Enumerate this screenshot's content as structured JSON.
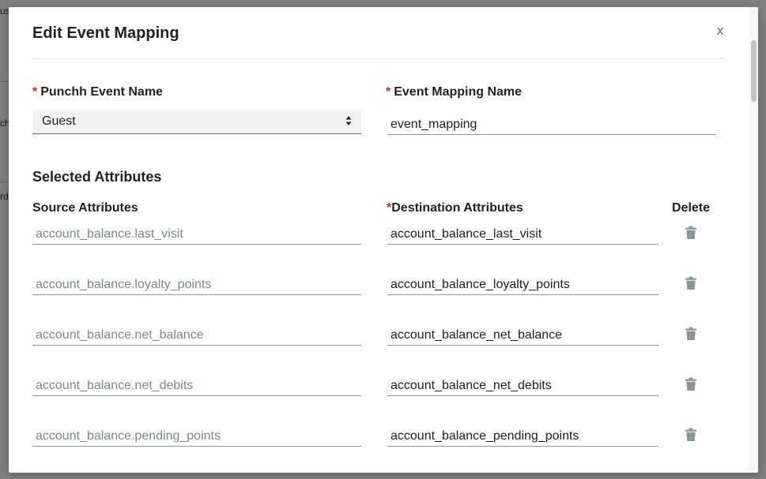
{
  "background": {
    "fragments": [
      "us",
      "ch",
      "rd"
    ]
  },
  "modal": {
    "title": "Edit Event Mapping",
    "close_label": "x",
    "event_name": {
      "required_mark": "*",
      "label": "Punchh Event Name",
      "selected": "Guest"
    },
    "mapping_name": {
      "required_mark": "*",
      "label": "Event Mapping Name",
      "value": "event_mapping"
    },
    "selected_attributes": {
      "title": "Selected Attributes",
      "source_header": "Source Attributes",
      "destination_required_mark": "*",
      "destination_header": "Destination Attributes",
      "delete_header": "Delete",
      "rows": [
        {
          "source": "account_balance.last_visit",
          "destination": "account_balance_last_visit"
        },
        {
          "source": "account_balance.loyalty_points",
          "destination": "account_balance_loyalty_points"
        },
        {
          "source": "account_balance.net_balance",
          "destination": "account_balance_net_balance"
        },
        {
          "source": "account_balance.net_debits",
          "destination": "account_balance_net_debits"
        },
        {
          "source": "account_balance.pending_points",
          "destination": "account_balance_pending_points"
        }
      ]
    }
  },
  "colors": {
    "required": "#e0261b",
    "trash": "#8c959c",
    "source_text": "#7d878d",
    "overlay": "rgba(0,0,0,0.5)"
  },
  "icons": {
    "close": "close-icon",
    "select_arrows": "sort-arrows-icon",
    "delete": "trash-icon"
  }
}
